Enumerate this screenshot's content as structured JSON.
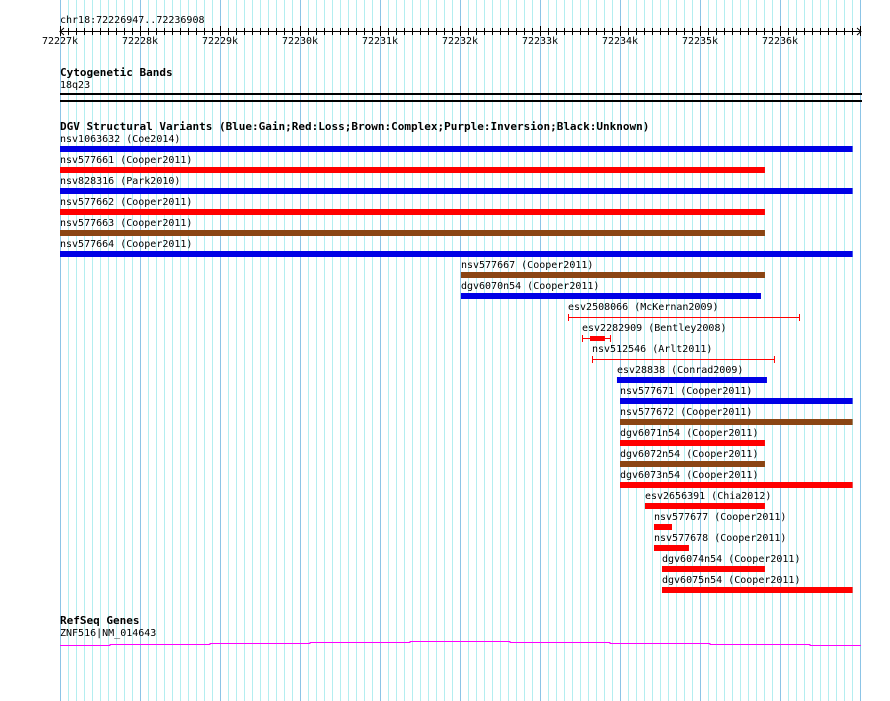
{
  "region_label": "chr18:72226947..72236908",
  "view": {
    "start": 72226947,
    "end": 72236908
  },
  "axis": {
    "ticks": [
      "72227k",
      "72228k",
      "72229k",
      "72230k",
      "72231k",
      "72232k",
      "72233k",
      "72234k",
      "72235k",
      "72236k"
    ]
  },
  "cytoband": {
    "title": "Cytogenetic Bands",
    "band": "18q23"
  },
  "dgv": {
    "title": "DGV Structural Variants (Blue:Gain;Red:Loss;Brown:Complex;Purple:Inversion;Black:Unknown)",
    "colors": {
      "gain": "#0000e6",
      "loss": "#ff0000",
      "complex": "#8b4513"
    },
    "features": [
      {
        "label": "nsv1063632 (Coe2014)",
        "type": "gain",
        "start": 72226947,
        "end": 72236908
      },
      {
        "label": "nsv577661 (Cooper2011)",
        "type": "loss",
        "start": 72226947,
        "end": 72235812
      },
      {
        "label": "nsv828316 (Park2010)",
        "type": "gain",
        "start": 72226947,
        "end": 72236908
      },
      {
        "label": "nsv577662 (Cooper2011)",
        "type": "loss",
        "start": 72226947,
        "end": 72235812
      },
      {
        "label": "nsv577663 (Cooper2011)",
        "type": "complex",
        "start": 72226947,
        "end": 72235812
      },
      {
        "label": "nsv577664 (Cooper2011)",
        "type": "gain",
        "start": 72226947,
        "end": 72236908
      },
      {
        "label": "nsv577667 (Cooper2011)",
        "type": "complex",
        "start": 72232012,
        "end": 72235812
      },
      {
        "label": "dgv6070n54 (Cooper2011)",
        "type": "gain",
        "start": 72232012,
        "end": 72235762
      },
      {
        "label": "esv2508066 (McKernan2009)",
        "type": "loss",
        "style": "thin",
        "start": 72233350,
        "end": 72236250
      },
      {
        "label": "esv2282909 (Bentley2008)",
        "type": "loss",
        "style": "thin",
        "start": 72233525,
        "end": 72233887,
        "thick_start": 72233625,
        "thick_end": 72233812
      },
      {
        "label": "nsv512546 (Arlt2011)",
        "type": "loss",
        "style": "thin",
        "start": 72233650,
        "end": 72235937
      },
      {
        "label": "esv28838 (Conrad2009)",
        "type": "gain",
        "start": 72233962,
        "end": 72235837
      },
      {
        "label": "nsv577671 (Cooper2011)",
        "type": "gain",
        "start": 72234000,
        "end": 72236908
      },
      {
        "label": "nsv577672 (Cooper2011)",
        "type": "complex",
        "start": 72234000,
        "end": 72236908
      },
      {
        "label": "dgv6071n54 (Cooper2011)",
        "type": "loss",
        "start": 72234000,
        "end": 72235812
      },
      {
        "label": "dgv6072n54 (Cooper2011)",
        "type": "complex",
        "start": 72234000,
        "end": 72235812
      },
      {
        "label": "dgv6073n54 (Cooper2011)",
        "type": "loss",
        "start": 72234000,
        "end": 72236908
      },
      {
        "label": "esv2656391 (Chia2012)",
        "type": "loss",
        "start": 72234312,
        "end": 72235812
      },
      {
        "label": "nsv577677 (Cooper2011)",
        "type": "loss",
        "start": 72234425,
        "end": 72234650
      },
      {
        "label": "nsv577678 (Cooper2011)",
        "type": "loss",
        "start": 72234425,
        "end": 72234862
      },
      {
        "label": "dgv6074n54 (Cooper2011)",
        "type": "loss",
        "start": 72234525,
        "end": 72235812
      },
      {
        "label": "dgv6075n54 (Cooper2011)",
        "type": "loss",
        "start": 72234525,
        "end": 72236908
      }
    ]
  },
  "refseq": {
    "title": "RefSeq Genes",
    "gene": "ZNF516|NM_014643",
    "color": "#ff00ff"
  }
}
